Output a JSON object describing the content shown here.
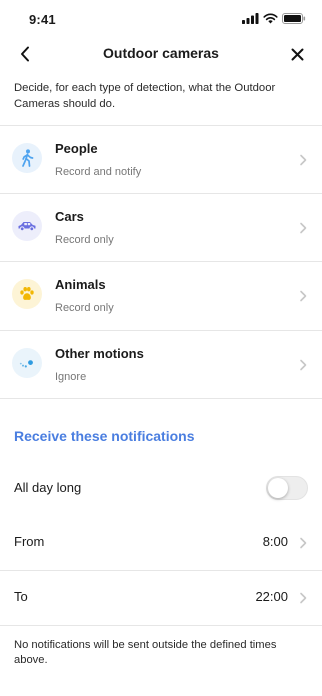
{
  "status_bar": {
    "time": "9:41"
  },
  "header": {
    "title": "Outdoor cameras",
    "back_icon": "chevron-left-icon",
    "close_icon": "close-icon"
  },
  "intro_text": "Decide, for each type of detection, what the Outdoor Cameras should do.",
  "detections": [
    {
      "label": "People",
      "action": "Record and notify",
      "icon": "person-walking-icon",
      "icon_color": "#4ea3ef",
      "icon_bg": "#e8f2fc"
    },
    {
      "label": "Cars",
      "action": "Record only",
      "icon": "car-icon",
      "icon_color": "#6a6fe0",
      "icon_bg": "#edeefb"
    },
    {
      "label": "Animals",
      "action": "Record only",
      "icon": "paw-icon",
      "icon_color": "#f2b705",
      "icon_bg": "#fdf4d6"
    },
    {
      "label": "Other motions",
      "action": "Ignore",
      "icon": "motion-icon",
      "icon_color": "#2f9be0",
      "icon_bg": "#eaf4fb"
    }
  ],
  "notifications": {
    "section_title": "Receive these notifications",
    "accent_color": "#4a7ee0",
    "all_day": {
      "label": "All day long",
      "enabled": false
    },
    "from": {
      "label": "From",
      "value": "8:00"
    },
    "to": {
      "label": "To",
      "value": "22:00"
    },
    "footer_note": "No notifications will be sent outside the defined times above."
  }
}
